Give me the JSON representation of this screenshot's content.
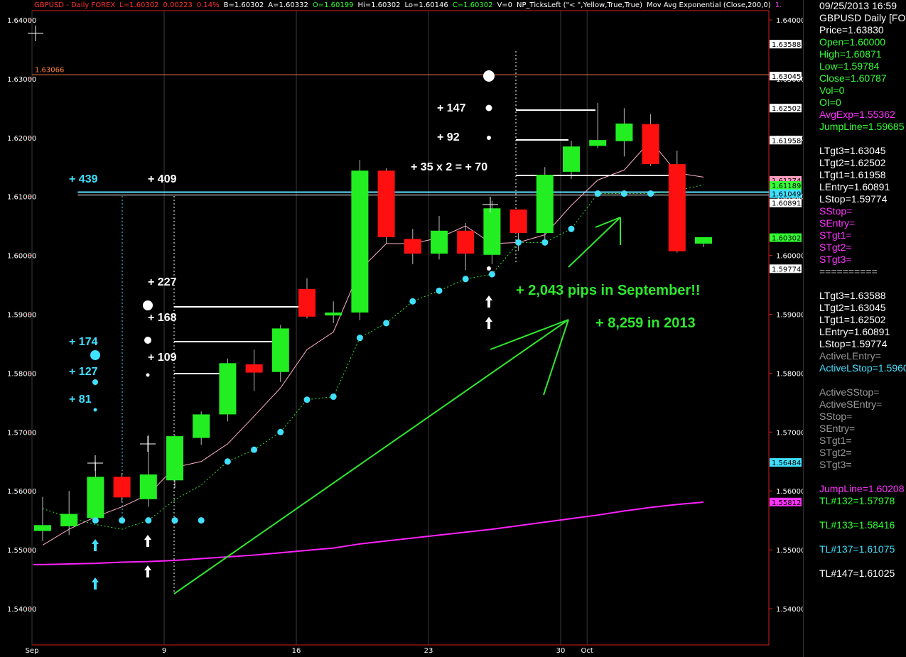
{
  "header": [
    {
      "text": "GBPUSD - Daily  FOREX",
      "color": "#ff3030"
    },
    {
      "text": "L=1.60302",
      "color": "#ff3030"
    },
    {
      "text": "0.00223",
      "color": "#ff3030"
    },
    {
      "text": "0.14%",
      "color": "#ff3030"
    },
    {
      "text": "B=1.60302",
      "color": "#ffffff"
    },
    {
      "text": "A=1.60332",
      "color": "#ffffff"
    },
    {
      "text": "O=1.60199",
      "color": "#33ff33"
    },
    {
      "text": "Hi=1.60302",
      "color": "#ffffff"
    },
    {
      "text": "Lo=1.60146",
      "color": "#ffffff"
    },
    {
      "text": "C=1.60302",
      "color": "#33ff33"
    },
    {
      "text": "V=0",
      "color": "#ffffff"
    },
    {
      "text": "NP_TicksLeft (\"< \",Yellow,True,True)",
      "color": "#ffffff"
    },
    {
      "text": "Mov Avg Exponential (Close,200,0)",
      "color": "#ffffff"
    },
    {
      "text": "1.",
      "color": "#ff33ff"
    }
  ],
  "chart_data": {
    "type": "candlestick",
    "symbol": "GBPUSD",
    "timeframe": "Daily",
    "ylim": [
      1.533,
      1.643
    ],
    "y_ticks": [
      "1.64000",
      "1.63000",
      "1.62000",
      "1.61000",
      "1.60000",
      "1.59000",
      "1.58000",
      "1.57000",
      "1.56000",
      "1.55000",
      "1.54000"
    ],
    "x_ticks": [
      {
        "label": "Sep",
        "i": 0
      },
      {
        "label": "9",
        "i": 5
      },
      {
        "label": "16",
        "i": 10
      },
      {
        "label": "23",
        "i": 15
      },
      {
        "label": "30",
        "i": 20
      },
      {
        "label": "Oct",
        "i": 21
      }
    ],
    "candles": [
      {
        "o": 1.5532,
        "h": 1.559,
        "l": 1.5515,
        "c": 1.5542
      },
      {
        "o": 1.554,
        "h": 1.56,
        "l": 1.5525,
        "c": 1.5561
      },
      {
        "o": 1.5554,
        "h": 1.5649,
        "l": 1.5545,
        "c": 1.5624
      },
      {
        "o": 1.5624,
        "h": 1.563,
        "l": 1.558,
        "c": 1.5589
      },
      {
        "o": 1.5586,
        "h": 1.5695,
        "l": 1.5573,
        "c": 1.5628
      },
      {
        "o": 1.5618,
        "h": 1.5695,
        "l": 1.5605,
        "c": 1.5693
      },
      {
        "o": 1.569,
        "h": 1.5735,
        "l": 1.5678,
        "c": 1.573
      },
      {
        "o": 1.573,
        "h": 1.5825,
        "l": 1.5718,
        "c": 1.5817
      },
      {
        "o": 1.5815,
        "h": 1.584,
        "l": 1.577,
        "c": 1.5801
      },
      {
        "o": 1.5802,
        "h": 1.5882,
        "l": 1.5785,
        "c": 1.5876
      },
      {
        "o": 1.5943,
        "h": 1.5961,
        "l": 1.5893,
        "c": 1.5896
      },
      {
        "o": 1.5898,
        "h": 1.5922,
        "l": 1.5885,
        "c": 1.5903
      },
      {
        "o": 1.5903,
        "h": 1.6162,
        "l": 1.589,
        "c": 1.6144
      },
      {
        "o": 1.6144,
        "h": 1.6148,
        "l": 1.602,
        "c": 1.6031
      },
      {
        "o": 1.6028,
        "h": 1.6045,
        "l": 1.5985,
        "c": 1.6003
      },
      {
        "o": 1.6003,
        "h": 1.6067,
        "l": 1.5993,
        "c": 1.6042
      },
      {
        "o": 1.6042,
        "h": 1.6055,
        "l": 1.5975,
        "c": 1.6003
      },
      {
        "o": 1.6001,
        "h": 1.6093,
        "l": 1.5985,
        "c": 1.608
      },
      {
        "o": 1.6078,
        "h": 1.6078,
        "l": 1.6008,
        "c": 1.6038
      },
      {
        "o": 1.6038,
        "h": 1.615,
        "l": 1.6025,
        "c": 1.6137
      },
      {
        "o": 1.6142,
        "h": 1.6195,
        "l": 1.613,
        "c": 1.6185
      },
      {
        "o": 1.6186,
        "h": 1.6259,
        "l": 1.6182,
        "c": 1.6196
      },
      {
        "o": 1.6194,
        "h": 1.625,
        "l": 1.6168,
        "c": 1.6224
      },
      {
        "o": 1.6223,
        "h": 1.624,
        "l": 1.6152,
        "c": 1.6155
      },
      {
        "o": 1.6155,
        "h": 1.6178,
        "l": 1.6005,
        "c": 1.6007
      },
      {
        "o": 1.602,
        "h": 1.6031,
        "l": 1.6014,
        "c": 1.6031
      }
    ],
    "ema_fast": [
      1.5508,
      1.5535,
      1.5556,
      1.5573,
      1.5594,
      1.564,
      1.565,
      1.568,
      1.5727,
      1.5775,
      1.584,
      1.587,
      1.5975,
      1.602,
      1.602,
      1.603,
      1.605,
      1.602,
      1.6022,
      1.6035,
      1.6085,
      1.6128,
      1.6145,
      1.6195,
      1.614,
      1.6133
    ],
    "stop_line": [
      1.557,
      1.5555,
      1.5543,
      1.5535,
      1.555,
      1.5585,
      1.561,
      1.565,
      1.567,
      1.57,
      1.5755,
      1.576,
      1.586,
      1.5885,
      1.5922,
      1.594,
      1.596,
      1.5968,
      1.6022,
      1.6022,
      1.6045,
      1.6105,
      1.6105,
      1.6105,
      1.611,
      1.612
    ],
    "stop_dots": [
      {
        "i": 2,
        "v": 1.555
      },
      {
        "i": 3,
        "v": 1.555
      },
      {
        "i": 4,
        "v": 1.555
      },
      {
        "i": 5,
        "v": 1.555
      },
      {
        "i": 6,
        "v": 1.555
      },
      {
        "i": 7,
        "v": 1.565
      },
      {
        "i": 8,
        "v": 1.567
      },
      {
        "i": 9,
        "v": 1.57
      },
      {
        "i": 10,
        "v": 1.5755
      },
      {
        "i": 11,
        "v": 1.576
      },
      {
        "i": 12,
        "v": 1.586
      },
      {
        "i": 13,
        "v": 1.5885
      },
      {
        "i": 14,
        "v": 1.5922
      },
      {
        "i": 15,
        "v": 1.594
      },
      {
        "i": 16,
        "v": 1.596
      },
      {
        "i": 17,
        "v": 1.5968
      },
      {
        "i": 18,
        "v": 1.6022
      },
      {
        "i": 19,
        "v": 1.6022
      },
      {
        "i": 20,
        "v": 1.6045
      },
      {
        "i": 21,
        "v": 1.6105
      },
      {
        "i": 22,
        "v": 1.6105
      },
      {
        "i": 23,
        "v": 1.6105
      }
    ],
    "ema200": [
      1.5475,
      1.5476,
      1.5477,
      1.5479,
      1.548,
      1.5482,
      1.5485,
      1.5488,
      1.5491,
      1.5495,
      1.5499,
      1.5503,
      1.551,
      1.5515,
      1.552,
      1.5525,
      1.553,
      1.5535,
      1.5541,
      1.5547,
      1.5553,
      1.5559,
      1.5566,
      1.5572,
      1.5577,
      1.5581
    ],
    "levels": [
      {
        "price": 1.63066,
        "label": "1.63066",
        "color": "#ff8040"
      },
      {
        "price": 1.61075,
        "color": "#60e0ff"
      },
      {
        "price": 1.61025,
        "color": "#ffffff"
      }
    ],
    "right_axis_labels": [
      {
        "v": 1.63588,
        "text": "1.63588",
        "bg": "#ffffff",
        "fg": "#000000"
      },
      {
        "v": 1.63045,
        "text": "1.63045",
        "bg": "#ffffff",
        "fg": "#000000"
      },
      {
        "v": 1.62502,
        "text": "1.62502",
        "bg": "#ffffff",
        "fg": "#000000"
      },
      {
        "v": 1.61958,
        "text": "1.61958",
        "bg": "#ffffff",
        "fg": "#000000"
      },
      {
        "v": 1.61274,
        "text": "1.61274",
        "bg": "#ff9fc0",
        "fg": "#000000"
      },
      {
        "v": 1.61189,
        "text": "1.61189",
        "bg": "#33ff33",
        "fg": "#000000"
      },
      {
        "v": 1.61049,
        "text": "1.61049",
        "bg": "#40e0ff",
        "fg": "#000000"
      },
      {
        "v": 1.60891,
        "text": "1.60891",
        "bg": "#ffffff",
        "fg": "#000000"
      },
      {
        "v": 1.60302,
        "text": "1.60302",
        "bg": "#33ff33",
        "fg": "#000000"
      },
      {
        "v": 1.59774,
        "text": "1.59774",
        "bg": "#ffffff",
        "fg": "#000000"
      },
      {
        "v": 1.56484,
        "text": "1.56484",
        "bg": "#40e0ff",
        "fg": "#000000"
      },
      {
        "v": 1.55812,
        "text": "1.55812",
        "bg": "#ff33ff",
        "fg": "#000000"
      }
    ],
    "annotations": [
      {
        "text": "+ 439",
        "color": "#40e0ff"
      },
      {
        "text": "+ 409",
        "color": "#ffffff"
      },
      {
        "text": "+ 227",
        "color": "#ffffff"
      },
      {
        "text": "+ 168",
        "color": "#ffffff"
      },
      {
        "text": "+ 109",
        "color": "#ffffff"
      },
      {
        "text": "+ 174",
        "color": "#40e0ff"
      },
      {
        "text": "+ 127",
        "color": "#40e0ff"
      },
      {
        "text": "+ 81",
        "color": "#40e0ff"
      },
      {
        "text": "+ 147",
        "color": "#ffffff"
      },
      {
        "text": "+ 92",
        "color": "#ffffff"
      },
      {
        "text": "+ 35 x 2 = + 70",
        "color": "#ffffff"
      }
    ],
    "notes": [
      "+ 2,043 pips in September!!",
      "+ 8,259 in 2013"
    ]
  },
  "sidebar": [
    {
      "text": "09/25/2013 16:59",
      "color": "#ffffff"
    },
    {
      "text": "GBPUSD Daily [FO",
      "color": "#ffffff"
    },
    {
      "text": "Price=1.63830",
      "color": "#ffffff"
    },
    {
      "text": "Open=1.60000",
      "color": "#33ff33"
    },
    {
      "text": "High=1.60871",
      "color": "#33ff33"
    },
    {
      "text": "Low=1.59784",
      "color": "#33ff33"
    },
    {
      "text": "Close=1.60787",
      "color": "#33ff33"
    },
    {
      "text": "Vol=0",
      "color": "#33ff33"
    },
    {
      "text": "OI=0",
      "color": "#33ff33"
    },
    {
      "text": "AvgExp=1.55362",
      "color": "#ff33ff"
    },
    {
      "text": "JumpLine=1.59685",
      "color": "#33ff33"
    },
    {
      "text": "",
      "color": "#ffffff"
    },
    {
      "text": "LTgt3=1.63045",
      "color": "#ffffff"
    },
    {
      "text": "LTgt2=1.62502",
      "color": "#ffffff"
    },
    {
      "text": "LTgt1=1.61958",
      "color": "#ffffff"
    },
    {
      "text": "LEntry=1.60891",
      "color": "#ffffff"
    },
    {
      "text": "LStop=1.59774",
      "color": "#ffffff"
    },
    {
      "text": "SStop=",
      "color": "#ff33ff"
    },
    {
      "text": "SEntry=",
      "color": "#ff33ff"
    },
    {
      "text": "STgt1=",
      "color": "#ff33ff"
    },
    {
      "text": "STgt2=",
      "color": "#ff33ff"
    },
    {
      "text": "STgt3=",
      "color": "#ff33ff"
    },
    {
      "text": "==========",
      "color": "#aaaaaa"
    },
    {
      "text": "",
      "color": "#ffffff"
    },
    {
      "text": "LTgt3=1.63588",
      "color": "#ffffff"
    },
    {
      "text": "LTgt2=1.63045",
      "color": "#ffffff"
    },
    {
      "text": "LTgt1=1.62502",
      "color": "#ffffff"
    },
    {
      "text": "LEntry=1.60891",
      "color": "#ffffff"
    },
    {
      "text": "LStop=1.59774",
      "color": "#ffffff"
    },
    {
      "text": "ActiveLEntry=",
      "color": "#999999"
    },
    {
      "text": "ActiveLStop=1.5960",
      "color": "#40e0ff"
    },
    {
      "text": "",
      "color": "#ffffff"
    },
    {
      "text": "ActiveSStop=",
      "color": "#999999"
    },
    {
      "text": "ActiveSEntry=",
      "color": "#999999"
    },
    {
      "text": "SStop=",
      "color": "#999999"
    },
    {
      "text": "SEntry=",
      "color": "#999999"
    },
    {
      "text": "STgt1=",
      "color": "#999999"
    },
    {
      "text": "STgt2=",
      "color": "#999999"
    },
    {
      "text": "STgt3=",
      "color": "#999999"
    },
    {
      "text": "",
      "color": "#ffffff"
    },
    {
      "text": "JumpLine=1.60208",
      "color": "#ff33ff"
    },
    {
      "text": "TL#132=1.57978",
      "color": "#33ff33"
    },
    {
      "text": "",
      "color": "#ffffff"
    },
    {
      "text": "TL#133=1.58416",
      "color": "#33ff33"
    },
    {
      "text": "",
      "color": "#ffffff"
    },
    {
      "text": "TL#137=1.61075",
      "color": "#40e0ff"
    },
    {
      "text": "",
      "color": "#ffffff"
    },
    {
      "text": "TL#147=1.61025",
      "color": "#ffffff"
    }
  ]
}
